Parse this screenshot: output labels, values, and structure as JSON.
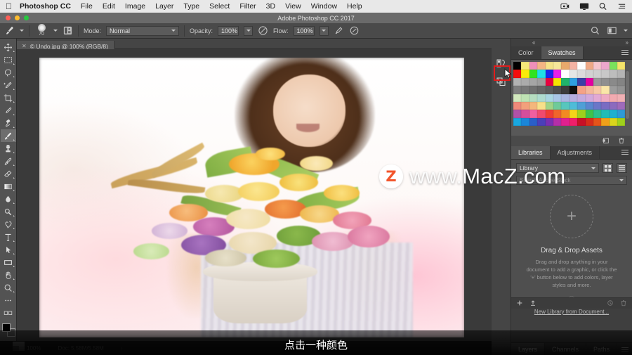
{
  "menubar": {
    "apple_icon": "apple-icon",
    "app_name": "Photoshop CC",
    "items": [
      "File",
      "Edit",
      "Image",
      "Layer",
      "Type",
      "Select",
      "Filter",
      "3D",
      "View",
      "Window",
      "Help"
    ],
    "right_icons": [
      "screen-record-icon",
      "display-icon",
      "search-icon",
      "list-icon"
    ]
  },
  "titlebar": {
    "title": "Adobe Photoshop CC 2017",
    "close_color": "#ff5f57",
    "minimize_color": "#febc2e",
    "zoom_color": "#28c840"
  },
  "options_bar": {
    "tool_icon": "brush-icon",
    "brush_size": "70",
    "brush_preset_icon": "brush-settings-icon",
    "mode_label": "Mode:",
    "mode_value": "Normal",
    "opacity_label": "Opacity:",
    "opacity_value": "100%",
    "opacity_pressure_icon": "pressure-opacity-icon",
    "flow_label": "Flow:",
    "flow_value": "100%",
    "airbrush_icon": "airbrush-icon",
    "smoothing_icon": "smoothing-icon",
    "search_icon": "search-icon",
    "workspace_icon": "workspace-icon"
  },
  "document_tab": {
    "close_icon": "close-icon",
    "label": "© Undo.jpg @ 100% (RGB/8)"
  },
  "toolbar": {
    "tools": [
      {
        "name": "move-tool",
        "icon": "move-icon",
        "active": false
      },
      {
        "name": "marquee-tool",
        "icon": "rectangular-marquee-icon",
        "active": false
      },
      {
        "name": "lasso-tool",
        "icon": "lasso-icon",
        "active": false
      },
      {
        "name": "quick-selection-tool",
        "icon": "quick-selection-icon",
        "active": false
      },
      {
        "name": "crop-tool",
        "icon": "crop-icon",
        "active": false
      },
      {
        "name": "eyedropper-tool",
        "icon": "eyedropper-icon",
        "active": false
      },
      {
        "name": "spot-healing-tool",
        "icon": "healing-brush-icon",
        "active": false
      },
      {
        "name": "brush-tool",
        "icon": "brush-icon",
        "active": true
      },
      {
        "name": "clone-stamp-tool",
        "icon": "clone-stamp-icon",
        "active": false
      },
      {
        "name": "history-brush-tool",
        "icon": "history-brush-icon",
        "active": false
      },
      {
        "name": "eraser-tool",
        "icon": "eraser-icon",
        "active": false
      },
      {
        "name": "gradient-tool",
        "icon": "gradient-icon",
        "active": false
      },
      {
        "name": "blur-tool",
        "icon": "blur-droplet-icon",
        "active": false
      },
      {
        "name": "dodge-tool",
        "icon": "dodge-icon",
        "active": false
      },
      {
        "name": "pen-tool",
        "icon": "pen-icon",
        "active": false
      },
      {
        "name": "type-tool",
        "icon": "type-icon",
        "active": false
      },
      {
        "name": "path-selection-tool",
        "icon": "path-arrow-icon",
        "active": false
      },
      {
        "name": "rectangle-tool",
        "icon": "rectangle-shape-icon",
        "active": false
      },
      {
        "name": "hand-tool",
        "icon": "hand-icon",
        "active": false
      },
      {
        "name": "zoom-tool",
        "icon": "magnifier-icon",
        "active": false
      },
      {
        "name": "edit-toolbar",
        "icon": "ellipsis-icon",
        "active": false
      }
    ],
    "foreground_color": "#000000",
    "background_color": "#4d4d4d"
  },
  "canvas": {
    "image_description": "Smiling woman holding a large bouquet of orange, yellow and pink flowers"
  },
  "watermark": {
    "logo_letter": "Z",
    "logo_color": "#f2552c",
    "text": "www.MacZ.com"
  },
  "right_dock": {
    "rail_icons": [
      "color-swatches-panel-icon",
      "adjustments-panel-icon"
    ],
    "highlight_color": "#e21b1b",
    "cursor_icon": "cursor-arrow-icon",
    "color_panel": {
      "tabs": [
        {
          "label": "Color",
          "active": false
        },
        {
          "label": "Swatches",
          "active": true
        }
      ],
      "menu_icon": "panel-menu-icon",
      "swatches": [
        "#000000",
        "#f5e97a",
        "#ef90b9",
        "#f3b584",
        "#f5e389",
        "#f6e79a",
        "#e8a96c",
        "#f3b3a4",
        "#fdfdfd",
        "#efa986",
        "#f6c6cd",
        "#eda7cd",
        "#7ae25c",
        "#f4e46a",
        "#f40d0d",
        "#fbea0b",
        "#31e321",
        "#1fe0e6",
        "#1b27ea",
        "#e820e6",
        "#ffffff",
        "#e6e6e6",
        "#dcdcdc",
        "#d2d2d2",
        "#cfcfcf",
        "#c8c8c8",
        "#bdbdbd",
        "#b4b4b4",
        "#b2b2b2",
        "#ababab",
        "#a5a5a5",
        "#9e9e9e",
        "#e8003f",
        "#f5e400",
        "#20b36a",
        "#2f9fe0",
        "#3b3fa5",
        "#e300a0",
        "#9a9a9a",
        "#8f8f8f",
        "#8a8a8a",
        "#848484",
        "#7e7e7e",
        "#777777",
        "#6f6f6f",
        "#666666",
        "#5c5c5c",
        "#4f4f4f",
        "#3b3b3b",
        "#111111",
        "#f4a287",
        "#f4b79c",
        "#f7c8a6",
        "#fae6a8",
        "#9c9c9c",
        "#939393",
        "#d2e8bd",
        "#bfe2b3",
        "#b6ddc0",
        "#aedbcf",
        "#a9d6e2",
        "#a8c6e6",
        "#a9b6e0",
        "#b5aee0",
        "#c3aade",
        "#d2a9dc",
        "#e2a9d4",
        "#eeaac3",
        "#f2aab0",
        "#f0b0b4",
        "#f08a7a",
        "#f2a07c",
        "#f4b77c",
        "#f7e08a",
        "#9fd488",
        "#6fca9a",
        "#58c6bd",
        "#4fbcd8",
        "#4f9fd6",
        "#5a86cf",
        "#6b76c8",
        "#7a6cc2",
        "#8c6bbe",
        "#9f6bba",
        "#b052a8",
        "#d44e9c",
        "#f05fa0",
        "#ef4a6e",
        "#ef3d36",
        "#f0652c",
        "#f28a22",
        "#f4d419",
        "#9fd01c",
        "#3fc24a",
        "#2ec08b",
        "#1fbcb4",
        "#1fb0cf",
        "#2f9ad6",
        "#19a7e0",
        "#1b86d8",
        "#2a5fc8",
        "#4b3fb8",
        "#7a2fb0",
        "#b42fa8",
        "#e0208f",
        "#ef1f6a",
        "#c71026",
        "#d62d1b",
        "#e4541a",
        "#efa01a",
        "#d9d41c",
        "#9fd01c"
      ],
      "new_swatch_icon": "new-swatch-icon",
      "delete_swatch_icon": "trash-icon"
    },
    "libraries_panel": {
      "tabs": [
        {
          "label": "Libraries",
          "active": true
        },
        {
          "label": "Adjustments",
          "active": false
        }
      ],
      "menu_icon": "panel-menu-icon",
      "library_select_value": "Library",
      "library_select_icon": "chevron-down-icon",
      "grid_view_icon": "grid-view-icon",
      "list_view_icon": "list-view-icon",
      "search_placeholder": "Search Adobe Stock",
      "add_icon": "plus-icon",
      "empty_title": "Drag & Drop Assets",
      "empty_desc": "Drag and drop anything in your document to add a graphic, or click the '+' button below to add colors, layer styles and more.",
      "help_icon": "help-icon",
      "new_library_link": "New Library from Document...",
      "footer_icons": [
        "add-content-icon",
        "upload-icon",
        "sync-icon",
        "trash-icon"
      ]
    },
    "bottom_tabs": [
      {
        "label": "Layers",
        "active": true
      },
      {
        "label": "Channels",
        "active": false
      },
      {
        "label": "Paths",
        "active": false
      }
    ],
    "bottom_menu_icon": "panel-menu-icon"
  },
  "status_bar": {
    "zoom": "100%",
    "doc_info": "Doc: 5.58M/5.58M",
    "expand_icon": "chevron-right-icon"
  },
  "subtitle": {
    "text": "点击一种颜色"
  }
}
